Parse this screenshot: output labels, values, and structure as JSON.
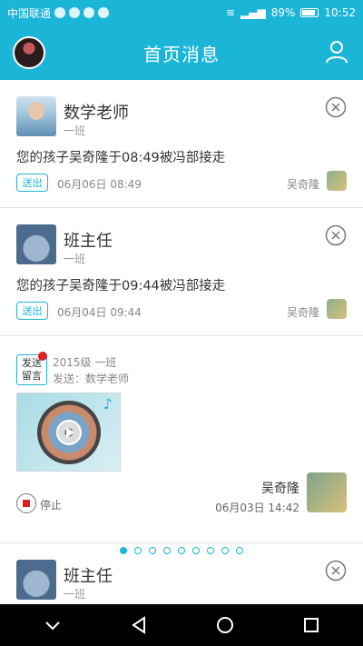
{
  "status_bar": {
    "carrier": "中国联通",
    "battery": "89%",
    "time": "10:52"
  },
  "app_bar": {
    "title": "首页消息"
  },
  "messages": [
    {
      "sender": "数学老师",
      "class_name": "一班",
      "text": "您的孩子吴奇隆于08:49被冯部接走",
      "tag": "送出",
      "timestamp": "06月06日 08:49",
      "student": "吴奇隆"
    },
    {
      "sender": "班主任",
      "class_name": "一班",
      "text": "您的孩子吴奇隆于09:44被冯部接走",
      "tag": "送出",
      "timestamp": "06月04日 09:44",
      "student": "吴奇隆"
    }
  ],
  "voice_message": {
    "badge_line1": "发送",
    "badge_line2": "留言",
    "grade": "2015级 一班",
    "send_to": "发送：数学老师",
    "stop_label": "停止",
    "student": "吴奇隆",
    "timestamp": "06月03日 14:42"
  },
  "last_message": {
    "sender": "班主任",
    "class_name": "一班"
  },
  "pager": {
    "total": 9,
    "active": 1
  },
  "colors": {
    "accent": "#1bb5d8",
    "alert": "#e02020"
  }
}
